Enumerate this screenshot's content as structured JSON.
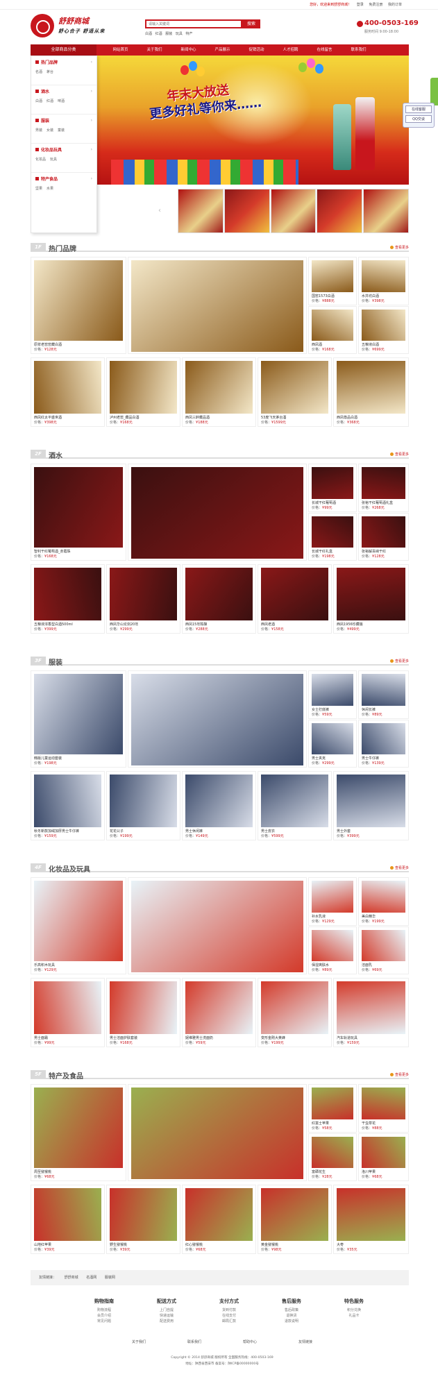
{
  "topbar": {
    "welcome": "您好，欢迎来到舒舒商城！",
    "login": "登录",
    "register": "免费注册",
    "my_orders": "我的订单",
    "favorites": "收藏"
  },
  "header": {
    "logo_name": "舒舒商城",
    "slogan": "舒心合子  舒适从来",
    "search_placeholder": "请输入关键词",
    "search_button": "搜索",
    "hotwords": [
      "白酒",
      "红酒",
      "服装",
      "玩具",
      "特产"
    ],
    "phone": "400-0503-169",
    "phone_hours": "服务时间 9:00-18:00"
  },
  "nav": {
    "all_label": "全部商品分类",
    "items": [
      "网站首页",
      "关于我们",
      "新闻中心",
      "产品展示",
      "促销活动",
      "人才招聘",
      "在线留言",
      "联系我们"
    ]
  },
  "sidebar": [
    {
      "title": "热门品牌",
      "subs": [
        "名酒",
        "茅台"
      ]
    },
    {
      "title": "酒水",
      "subs": [
        "白酒",
        "红酒",
        "啤酒"
      ]
    },
    {
      "title": "服装",
      "subs": [
        "男装",
        "女装",
        "童装"
      ]
    },
    {
      "title": "化妆品玩具",
      "subs": [
        "化妆品",
        "玩具"
      ]
    },
    {
      "title": "特产食品",
      "subs": [
        "坚果",
        "水果"
      ]
    }
  ],
  "banner": {
    "line1": "年末大放送",
    "line2": "更多好礼等你来……"
  },
  "floors": [
    {
      "num": "1F",
      "title": "热门品牌",
      "more": "查看更多",
      "products": [
        {
          "name": "原浆老窖窖藏白酒",
          "price": "¥128元"
        },
        {
          "name": "",
          "price": ""
        },
        {
          "name": "国窖1573白酒",
          "price": "¥888元"
        },
        {
          "name": "水井坊白酒",
          "price": "¥398元"
        },
        {
          "name": "西凤酒",
          "price": "¥168元"
        },
        {
          "name": "五粮液白酒",
          "price": "¥699元"
        },
        {
          "name": "西凤红太平盛世酒",
          "price": "¥398元"
        },
        {
          "name": "泸州老窖_藏品白酒",
          "price": "¥168元"
        },
        {
          "name": "西凤三醉藏品酒",
          "price": "¥188元"
        },
        {
          "name": "53度飞天茅台酒",
          "price": "¥1599元"
        },
        {
          "name": "西凤尊品白酒",
          "price": "¥368元"
        }
      ]
    },
    {
      "num": "2F",
      "title": "酒水",
      "more": "查看更多",
      "products": [
        {
          "name": "智利干红葡萄酒_赤霞珠",
          "price": "¥168元"
        },
        {
          "name": "",
          "price": ""
        },
        {
          "name": "长城干红葡萄酒",
          "price": "¥99元"
        },
        {
          "name": "张裕干红葡萄酒礼盒",
          "price": "¥268元"
        },
        {
          "name": "长城干红礼盒",
          "price": "¥198元"
        },
        {
          "name": "张裕解百纳干红",
          "price": "¥128元"
        },
        {
          "name": "五粮液浓香型白酒500ml",
          "price": "¥399元"
        },
        {
          "name": "西凤华山论剑20年",
          "price": "¥299元"
        },
        {
          "name": "西凤15年陈酿",
          "price": "¥288元"
        },
        {
          "name": "西凤老酒",
          "price": "¥158元"
        },
        {
          "name": "西凤1956珍藏版",
          "price": "¥499元"
        }
      ]
    },
    {
      "num": "3F",
      "title": "服装",
      "more": "查看更多",
      "products": [
        {
          "name": "韩版儿童运动套装",
          "price": "¥198元"
        },
        {
          "name": "",
          "price": ""
        },
        {
          "name": "女士打底裤",
          "price": "¥59元"
        },
        {
          "name": "休闲长裤",
          "price": "¥89元"
        },
        {
          "name": "男士夹克",
          "price": "¥299元"
        },
        {
          "name": "男士牛仔裤",
          "price": "¥139元"
        },
        {
          "name": "秋冬新款加绒加厚男士牛仔裤",
          "price": "¥159元"
        },
        {
          "name": "花花公子",
          "price": "¥199元"
        },
        {
          "name": "男士休闲裤",
          "price": "¥149元"
        },
        {
          "name": "男士皮衣",
          "price": "¥599元"
        },
        {
          "name": "男士外套",
          "price": "¥399元"
        }
      ]
    },
    {
      "num": "4F",
      "title": "化妆品及玩具",
      "more": "查看更多",
      "products": [
        {
          "name": "乐高积木玩具",
          "price": "¥129元"
        },
        {
          "name": "",
          "price": ""
        },
        {
          "name": "补水乳液",
          "price": "¥129元"
        },
        {
          "name": "美白精华",
          "price": "¥199元"
        },
        {
          "name": "保湿爽肤水",
          "price": "¥89元"
        },
        {
          "name": "洁面乳",
          "price": "¥69元"
        },
        {
          "name": "男士面霜",
          "price": "¥99元"
        },
        {
          "name": "男士洁面护肤套装",
          "price": "¥168元"
        },
        {
          "name": "妮维雅男士洗面奶",
          "price": "¥59元"
        },
        {
          "name": "变形金刚大黄蜂",
          "price": "¥199元"
        },
        {
          "name": "汽车轨道玩具",
          "price": "¥159元"
        }
      ]
    },
    {
      "num": "5F",
      "title": "特产及食品",
      "more": "查看更多",
      "products": [
        {
          "name": "周至猕猴桃",
          "price": "¥68元"
        },
        {
          "name": "",
          "price": ""
        },
        {
          "name": "红富士苹果",
          "price": "¥58元"
        },
        {
          "name": "干虫草花",
          "price": "¥88元"
        },
        {
          "name": "富硒花生",
          "price": "¥28元"
        },
        {
          "name": "洛川苹果",
          "price": "¥68元"
        },
        {
          "name": "山地红苹果",
          "price": "¥39元"
        },
        {
          "name": "野生猕猴桃",
          "price": "¥39元"
        },
        {
          "name": "红心猕猴桃",
          "price": "¥68元"
        },
        {
          "name": "黄金猕猴桃",
          "price": "¥98元"
        },
        {
          "name": "大枣",
          "price": "¥35元"
        }
      ]
    }
  ],
  "price_label": "价格：",
  "footer": {
    "links_label": "友情链接：",
    "links": [
      "舒舒商城",
      "名酒网",
      "服装网"
    ],
    "help": [
      {
        "title": "购物指南",
        "items": [
          "购物流程",
          "会员介绍",
          "常见问题"
        ]
      },
      {
        "title": "配送方式",
        "items": [
          "上门自提",
          "快递运输",
          "配送费用"
        ]
      },
      {
        "title": "支付方式",
        "items": [
          "货到付款",
          "在线支付",
          "邮局汇款"
        ]
      },
      {
        "title": "售后服务",
        "items": [
          "售后政策",
          "退换货",
          "退款说明"
        ]
      },
      {
        "title": "特色服务",
        "items": [
          "积分兑换",
          "礼品卡"
        ]
      }
    ],
    "bottom_links": [
      "关于我们",
      "联系我们",
      "帮助中心",
      "友情链接"
    ],
    "copyright_1": "Copyright © 2014 舒舒商城 版权所有 全国服务热线：400-0503-169",
    "copyright_2": "地址：陕西省西安市 备案号：陕ICP备00000000号"
  },
  "float": {
    "service_label": "在线客服",
    "qq_label": "QQ交谈"
  }
}
